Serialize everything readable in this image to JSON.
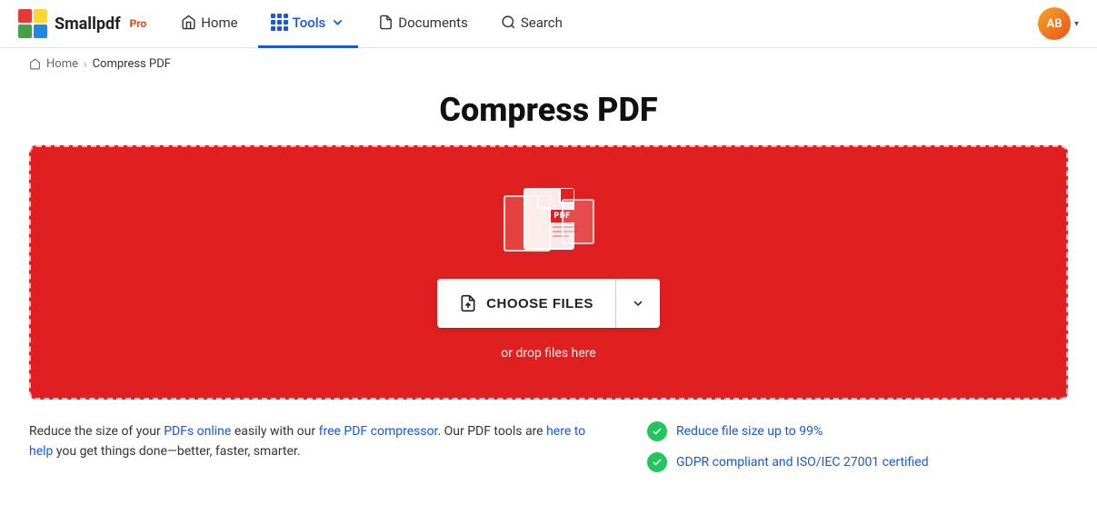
{
  "nav": {
    "logo_text": "Smallpdf",
    "logo_pro": "Pro",
    "items": [
      {
        "id": "home",
        "label": "Home",
        "active": false,
        "icon": "home-icon"
      },
      {
        "id": "tools",
        "label": "Tools",
        "active": true,
        "icon": "grid-icon"
      },
      {
        "id": "documents",
        "label": "Documents",
        "active": false,
        "icon": "doc-icon"
      },
      {
        "id": "search",
        "label": "Search",
        "active": false,
        "icon": "search-icon"
      }
    ],
    "avatar_initials": "AB"
  },
  "breadcrumb": {
    "home_label": "Home",
    "separator": "›",
    "current": "Compress PDF"
  },
  "page": {
    "title": "Compress PDF"
  },
  "dropzone": {
    "choose_files_label": "CHOOSE FILES",
    "drop_text": "or drop files here",
    "pdf_label": "PDF"
  },
  "bottom": {
    "description": "Reduce the size of your PDFs online easily with our free PDF compressor. Our PDF tools are here to help you get things done—better, faster, smarter.",
    "features": [
      {
        "text": "Reduce file size up to 99%"
      },
      {
        "text": "GDPR compliant and ISO/IEC 27001 certified"
      }
    ]
  }
}
